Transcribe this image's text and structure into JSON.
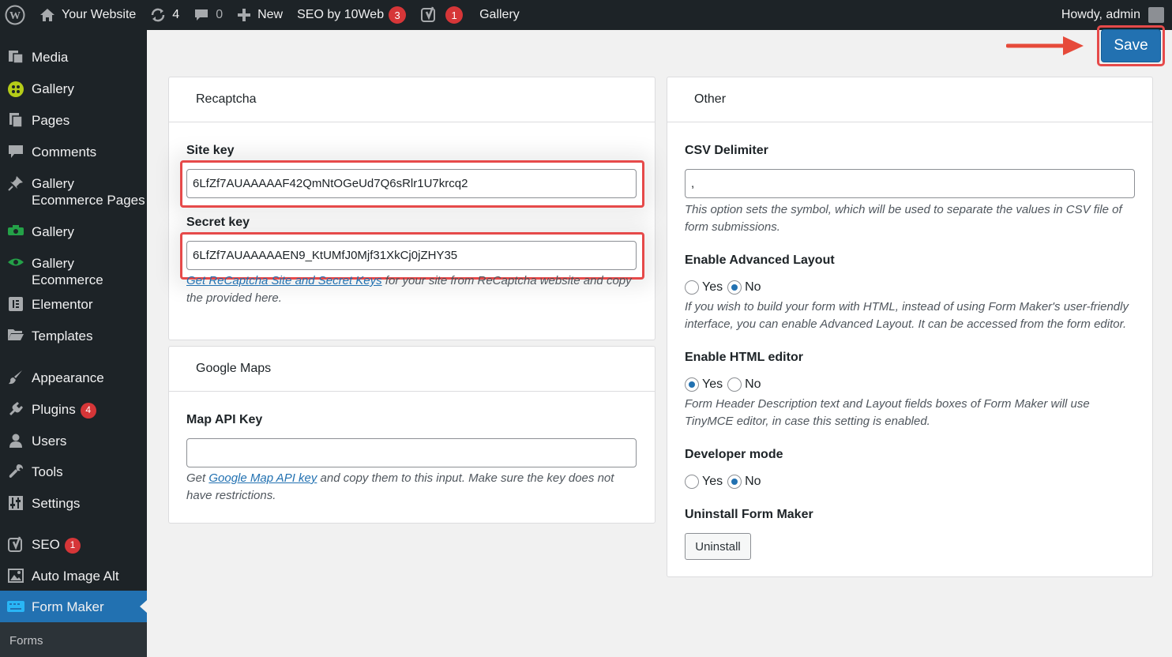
{
  "adminbar": {
    "site_name": "Your Website",
    "updates_count": "4",
    "comments_count": "0",
    "new_label": "New",
    "seo_label": "SEO by 10Web",
    "seo_count": "3",
    "yoast_count": "1",
    "gallery_label": "Gallery",
    "howdy": "Howdy, admin"
  },
  "sidebar": {
    "items": [
      {
        "label": "Media",
        "icon": "media-icon"
      },
      {
        "label": "Gallery",
        "icon": "gallery-icon"
      },
      {
        "label": "Pages",
        "icon": "pages-icon"
      },
      {
        "label": "Comments",
        "icon": "comments-icon"
      },
      {
        "label": "Gallery Ecommerce Pages",
        "icon": "pin-icon"
      },
      {
        "label": "Gallery",
        "icon": "camera-icon"
      },
      {
        "label": "Gallery Ecommerce",
        "icon": "eye-icon"
      },
      {
        "label": "Elementor",
        "icon": "elementor-icon"
      },
      {
        "label": "Templates",
        "icon": "folder-icon"
      },
      {
        "label": "Appearance",
        "icon": "brush-icon"
      },
      {
        "label": "Plugins",
        "icon": "plugin-icon",
        "badge": "4"
      },
      {
        "label": "Users",
        "icon": "user-icon"
      },
      {
        "label": "Tools",
        "icon": "wrench-icon"
      },
      {
        "label": "Settings",
        "icon": "settings-icon"
      },
      {
        "label": "SEO",
        "icon": "yoast-icon",
        "badge": "1"
      },
      {
        "label": "Auto Image Alt",
        "icon": "image-alt-icon"
      },
      {
        "label": "Form Maker",
        "icon": "keyboard-icon"
      }
    ],
    "submenu_label": "Forms"
  },
  "save_label": "Save",
  "recaptcha": {
    "title": "Recaptcha",
    "site_key_label": "Site key",
    "site_key_value": "6LfZf7AUAAAAAF42QmNtOGeUd7Q6sRlr1U7krcq2",
    "secret_key_label": "Secret key",
    "secret_key_value": "6LfZf7AUAAAAAEN9_KtUMfJ0Mjf31XkCj0jZHY35",
    "help_link": "Get ReCaptcha Site and Secret Keys",
    "help_rest": " for your site from ReCaptcha website and copy the provided here."
  },
  "maps": {
    "title": "Google Maps",
    "api_key_label": "Map API Key",
    "api_key_value": "",
    "help_pre": "Get ",
    "help_link": "Google Map API key",
    "help_rest": " and copy them to this input. Make sure the key does not have restrictions."
  },
  "other": {
    "title": "Other",
    "csv_label": "CSV Delimiter",
    "csv_value": ",",
    "csv_help": "This option sets the symbol, which will be used to separate the values in CSV file of form submissions.",
    "advanced_label": "Enable Advanced Layout",
    "advanced_help": "If you wish to build your form with HTML, instead of using Form Maker's user-friendly interface, you can enable Advanced Layout. It can be accessed from the form editor.",
    "html_editor_label": "Enable HTML editor",
    "html_editor_help": "Form Header Description text and Layout fields boxes of Form Maker will use TinyMCE editor, in case this setting is enabled.",
    "developer_label": "Developer mode",
    "uninstall_label": "Uninstall Form Maker",
    "uninstall_button": "Uninstall",
    "yes": "Yes",
    "no": "No"
  },
  "colors": {
    "accent": "#2271b1",
    "highlight": "#e64a4a",
    "sidebar_bg": "#1d2327"
  }
}
